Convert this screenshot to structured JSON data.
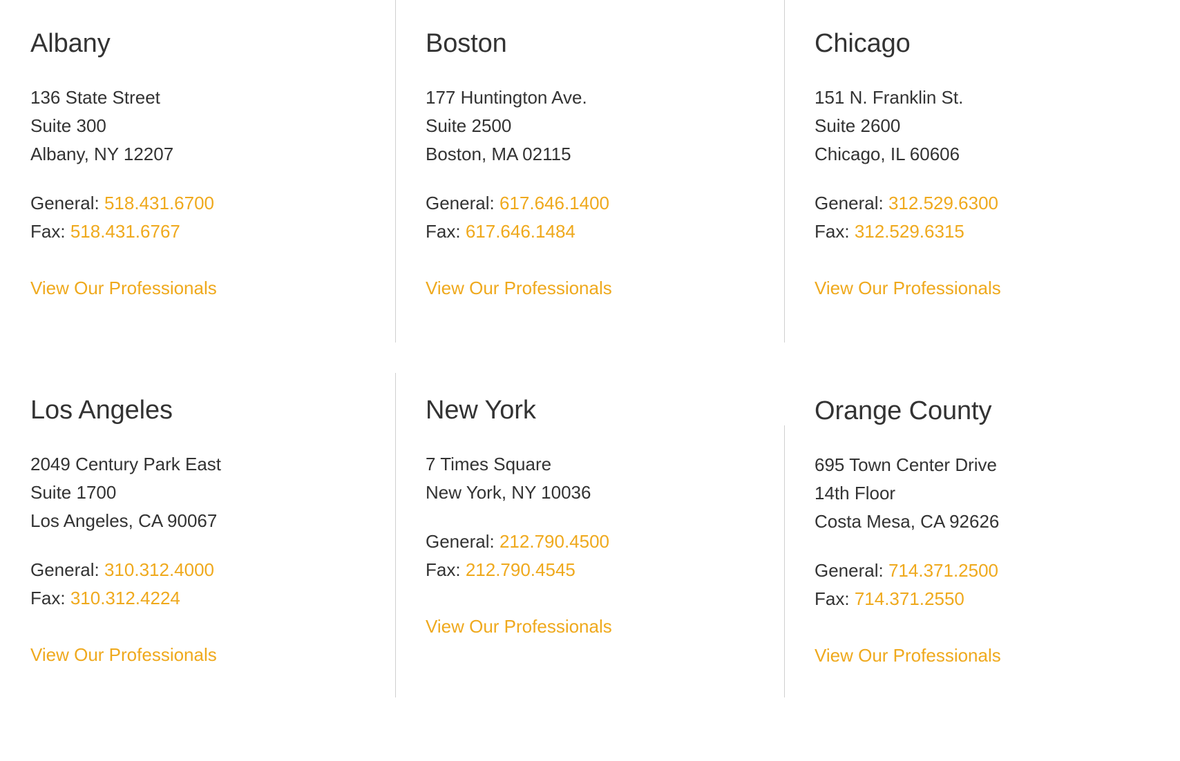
{
  "theme": {
    "accent_color": "#efa91d",
    "text_color": "#333333",
    "divider_color": "#cfcfcf",
    "background_color": "#ffffff"
  },
  "labels": {
    "general": "General:",
    "fax": "Fax:",
    "view_professionals": "View Our Professionals"
  },
  "offices": [
    {
      "name": "Albany",
      "address": [
        "136 State Street",
        "Suite 300",
        "Albany, NY 12207"
      ],
      "general_label": "General:",
      "general_phone": "518.431.6700",
      "fax_label": "Fax:",
      "fax_phone": "518.431.6767",
      "link_label": "View Our Professionals"
    },
    {
      "name": "Boston",
      "address": [
        "177 Huntington Ave.",
        "Suite 2500",
        "Boston, MA 02115"
      ],
      "general_label": "General:",
      "general_phone": "617.646.1400",
      "fax_label": "Fax:",
      "fax_phone": "617.646.1484",
      "link_label": "View Our Professionals"
    },
    {
      "name": "Chicago",
      "address": [
        "151 N. Franklin St.",
        "Suite 2600",
        "Chicago, IL 60606"
      ],
      "general_label": "General:",
      "general_phone": "312.529.6300",
      "fax_label": "Fax:",
      "fax_phone": "312.529.6315",
      "link_label": "View Our Professionals"
    },
    {
      "name": "Los Angeles",
      "address": [
        "2049 Century Park East",
        "Suite 1700",
        "Los Angeles, CA 90067"
      ],
      "general_label": "General:",
      "general_phone": "310.312.4000",
      "fax_label": "Fax:",
      "fax_phone": "310.312.4224",
      "link_label": "View Our Professionals"
    },
    {
      "name": "New York",
      "address": [
        "7 Times Square",
        "New York, NY 10036"
      ],
      "general_label": "General:",
      "general_phone": "212.790.4500",
      "fax_label": "Fax:",
      "fax_phone": "212.790.4545",
      "link_label": "View Our Professionals"
    },
    {
      "name": "Orange County",
      "address": [
        "695 Town Center Drive",
        "14th Floor",
        "Costa Mesa, CA 92626"
      ],
      "general_label": "General:",
      "general_phone": "714.371.2500",
      "fax_label": "Fax:",
      "fax_phone": "714.371.2550",
      "link_label": "View Our Professionals"
    }
  ]
}
